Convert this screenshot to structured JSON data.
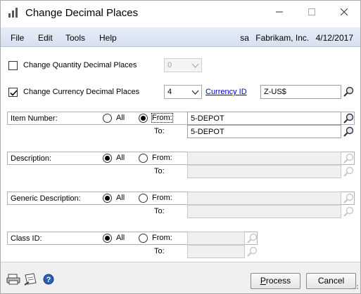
{
  "window": {
    "title": "Change Decimal Places",
    "controls": [
      "minimize-icon",
      "maximize-icon",
      "close-icon"
    ]
  },
  "menu": {
    "items": [
      "File",
      "Edit",
      "Tools",
      "Help"
    ],
    "user": "sa",
    "company": "Fabrikam, Inc.",
    "date": "4/12/2017"
  },
  "quantity": {
    "label": "Change Quantity Decimal Places",
    "checked": false,
    "value": "0",
    "disabled": true
  },
  "currency": {
    "label": "Change Currency Decimal Places",
    "checked": true,
    "value": "4",
    "link_label": "Currency ID",
    "currency_id": "Z-US$"
  },
  "ranges": [
    {
      "label": "Item Number:",
      "all_label": "All",
      "from_label": "From:",
      "to_label": "To:",
      "selected": "from",
      "from_value": "5-DEPOT",
      "to_value": "5-DEPOT"
    },
    {
      "label": "Description:",
      "all_label": "All",
      "from_label": "From:",
      "to_label": "To:",
      "selected": "all",
      "from_value": "",
      "to_value": ""
    },
    {
      "label": "Generic Description:",
      "all_label": "All",
      "from_label": "From:",
      "to_label": "To:",
      "selected": "all",
      "from_value": "",
      "to_value": ""
    },
    {
      "label": "Class ID:",
      "all_label": "All",
      "from_label": "From:",
      "to_label": "To:",
      "selected": "all",
      "from_value": "",
      "to_value": ""
    }
  ],
  "buttons": {
    "process": "Process",
    "process_mnemonic": "P",
    "process_rest": "rocess",
    "cancel": "Cancel"
  },
  "footer_icons": [
    "printer-icon",
    "note-icon",
    "help-icon"
  ]
}
